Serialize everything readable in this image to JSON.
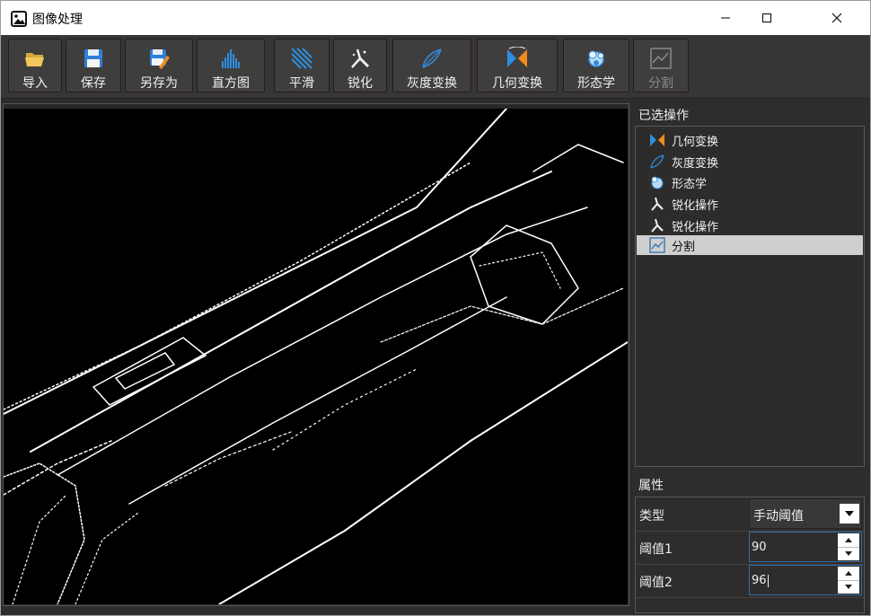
{
  "window": {
    "title": "图像处理",
    "minimize_icon": "minimize-icon",
    "maximize_icon": "maximize-icon",
    "close_icon": "close-icon"
  },
  "toolbar": {
    "buttons": [
      {
        "label": "导入",
        "icon": "folder-open-icon"
      },
      {
        "label": "保存",
        "icon": "floppy-disk-icon"
      },
      {
        "label": "另存为",
        "icon": "floppy-pen-icon"
      },
      {
        "label": "直方图",
        "icon": "histogram-icon"
      },
      {
        "label": "平滑",
        "icon": "smooth-lines-icon"
      },
      {
        "label": "锐化",
        "icon": "sharpen-wand-icon"
      },
      {
        "label": "灰度变换",
        "icon": "gray-transform-icon"
      },
      {
        "label": "几何变换",
        "icon": "geometry-flip-icon"
      },
      {
        "label": "形态学",
        "icon": "morphology-icon"
      },
      {
        "label": "分割",
        "icon": "segment-icon",
        "disabled": true
      }
    ]
  },
  "canvas": {
    "content": "edge-detection-result-image",
    "background": "#000000",
    "foreground": "#ffffff"
  },
  "operations": {
    "title": "已选操作",
    "items": [
      {
        "label": "几何变换",
        "icon": "geometry-flip-icon"
      },
      {
        "label": "灰度变换",
        "icon": "gray-transform-icon"
      },
      {
        "label": "形态学",
        "icon": "morphology-icon"
      },
      {
        "label": "锐化操作",
        "icon": "sharpen-wand-icon"
      },
      {
        "label": "锐化操作",
        "icon": "sharpen-wand-icon"
      },
      {
        "label": "分割",
        "icon": "segment-icon",
        "selected": true
      }
    ]
  },
  "properties": {
    "title": "属性",
    "rows": [
      {
        "label": "类型",
        "value": "手动阈值",
        "kind": "combo"
      },
      {
        "label": "阈值1",
        "value": "90",
        "kind": "spin"
      },
      {
        "label": "阈值2",
        "value": "96",
        "kind": "spin",
        "focused": true
      }
    ]
  },
  "colors": {
    "panel": "#2f2d2c",
    "toolbar": "#383635",
    "selection": "#cfcfcf",
    "focus": "#2f6fa8",
    "accent_blue": "#2d8ee0",
    "accent_orange": "#f08c1e"
  }
}
